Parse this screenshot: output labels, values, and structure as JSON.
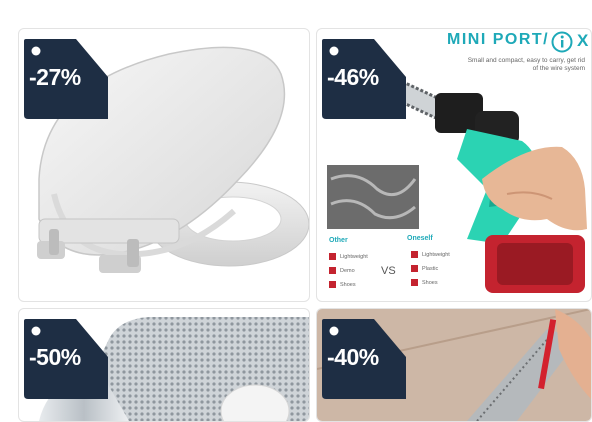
{
  "products": [
    {
      "discount": "-27%",
      "image": "toilet-seat"
    },
    {
      "discount": "-46%",
      "image": "mini-chainsaw"
    },
    {
      "discount": "-50%",
      "image": "insulation-roll"
    },
    {
      "discount": "-40%",
      "image": "ruler-marking"
    }
  ],
  "ad": {
    "headline": "MINI PORT/",
    "subtext": "Small and compact, easy to carry, get rid of the wire system",
    "info_icon": "info-icon",
    "close_icon": "close-icon",
    "close_glyph": "X",
    "other_label": "Other",
    "ours_label": "Oneself",
    "other_items": [
      "Lightweight",
      "Demo",
      "Shoes"
    ],
    "ours_items": [
      "Lightweight",
      "Plastic",
      "Shoes"
    ],
    "vs": "VS"
  },
  "colors": {
    "tag": "#1e2e44",
    "accent": "#1ea9b8",
    "tool_body": "#2bd3b3",
    "battery": "#c4232f"
  }
}
